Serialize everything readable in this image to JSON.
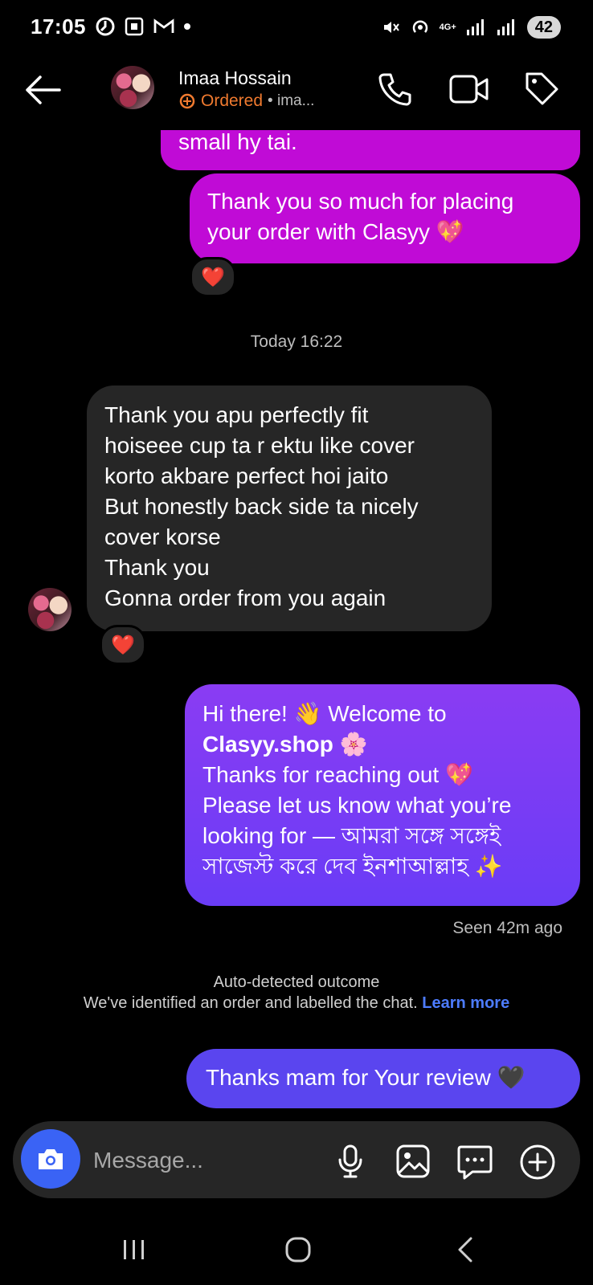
{
  "status_bar": {
    "time": "17:05",
    "network": "4G+",
    "battery": "42"
  },
  "header": {
    "back_icon": "arrow-left-icon",
    "contact_name": "Imaa Hossain",
    "order_label": "Ordered",
    "handle": "• ima...",
    "actions": [
      "phone-icon",
      "video-camera-icon",
      "tag-icon"
    ]
  },
  "messages": {
    "partial_top": "small hy tai.",
    "thank_you_order": "Thank you so much for placing your order with Clasyy 💖",
    "reaction_1": "❤️",
    "timestamp": "Today 16:22",
    "incoming_lines": [
      "Thank you apu perfectly fit",
      "hoiseee cup ta r ektu like cover",
      "korto akbare perfect hoi jaito",
      "But honestly back side ta nicely",
      "cover korse",
      "Thank you",
      "Gonna order from you again"
    ],
    "reaction_2": "❤️",
    "welcome_line1": "Hi there! 👋 Welcome to",
    "welcome_brand": "Clasyy.shop",
    "welcome_brand_emoji": "🌸",
    "welcome_line3": "Thanks for reaching out 💖",
    "welcome_line4": "Please let us know what you’re",
    "welcome_line5": "looking for — আমরা সঙ্গে সঙ্গেই",
    "welcome_line6": "সাজেস্ট করে দেব ইনশাআল্লাহ ✨",
    "seen": "Seen 42m ago",
    "auto_title": "Auto-detected outcome",
    "auto_body": "We've identified an order and labelled the chat.",
    "auto_link": "Learn more",
    "final_reply": "Thanks mam for Your review 🖤"
  },
  "composer": {
    "placeholder": "Message...",
    "icons": [
      "camera-icon",
      "microphone-icon",
      "image-icon",
      "sticker-chat-icon",
      "plus-circle-icon"
    ]
  },
  "colors": {
    "magenta_bubble": "#c00bd6",
    "purple_bubble": "#7a3cf4",
    "indigo_bubble": "#5a45ef",
    "incoming_bubble": "#262626",
    "ordered_orange": "#f07a2f",
    "link_blue": "#4d7cff"
  }
}
